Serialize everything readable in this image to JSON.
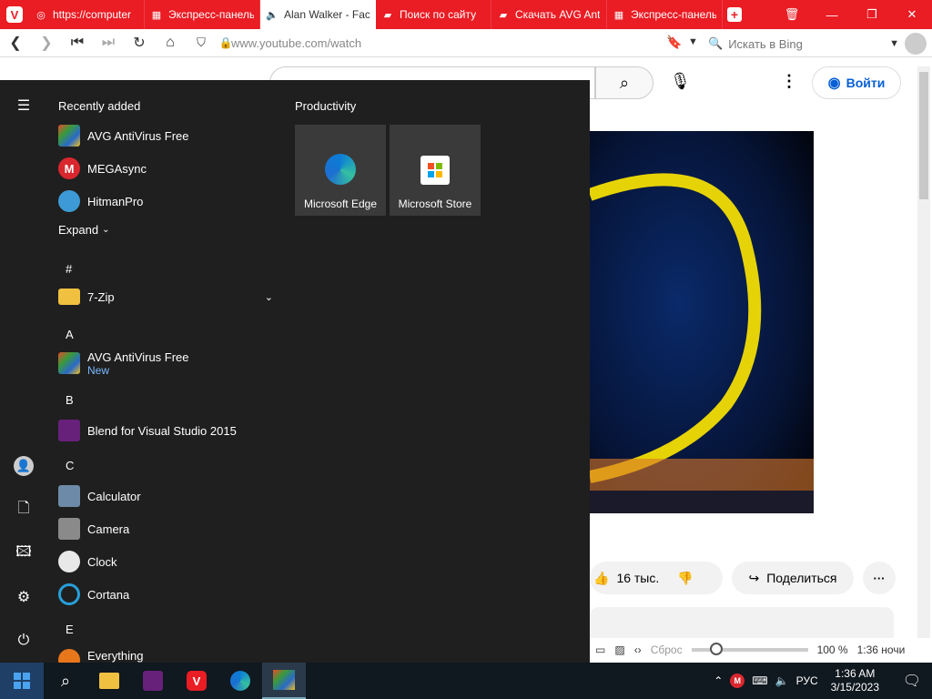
{
  "browser": {
    "tabs": [
      {
        "label": "https://computer",
        "icon": "wiki-icon"
      },
      {
        "label": "Экспресс-панель",
        "icon": "grid-icon"
      },
      {
        "label": "Alan Walker - Fac",
        "icon": "speaker-icon"
      },
      {
        "label": "Поиск по сайту",
        "icon": "avg-icon"
      },
      {
        "label": "Скачать AVG Ant",
        "icon": "avg-icon"
      },
      {
        "label": "Экспресс-панель",
        "icon": "grid-icon"
      }
    ],
    "url": "www.youtube.com/watch",
    "search_placeholder": "Искать в Bing"
  },
  "youtube": {
    "signin": "Войти",
    "likes": "16 тыс.",
    "share": "Поделиться"
  },
  "status": {
    "reset": "Сброс",
    "zoom": "100 %",
    "time": "1:36 ночи"
  },
  "start": {
    "recently_added_title": "Recently added",
    "recent": [
      "AVG AntiVirus Free",
      "MEGAsync",
      "HitmanPro"
    ],
    "expand": "Expand",
    "groups": [
      {
        "letter": "#",
        "apps": [
          {
            "name": "7-Zip"
          }
        ]
      },
      {
        "letter": "A",
        "apps": [
          {
            "name": "AVG AntiVirus Free",
            "sub": "New"
          }
        ]
      },
      {
        "letter": "B",
        "apps": [
          {
            "name": "Blend for Visual Studio 2015"
          }
        ]
      },
      {
        "letter": "C",
        "apps": [
          {
            "name": "Calculator"
          },
          {
            "name": "Camera"
          },
          {
            "name": "Clock"
          },
          {
            "name": "Cortana"
          }
        ]
      },
      {
        "letter": "E",
        "apps": [
          {
            "name": "Everything"
          }
        ]
      }
    ],
    "productivity_title": "Productivity",
    "tiles": [
      "Microsoft Edge",
      "Microsoft Store"
    ]
  },
  "tray": {
    "lang": "РУС",
    "time": "1:36 AM",
    "date": "3/15/2023"
  },
  "colors": {
    "vivaldi_red": "#ea1c24",
    "start_bg": "#1f1f1f",
    "taskbar": "#101820"
  }
}
